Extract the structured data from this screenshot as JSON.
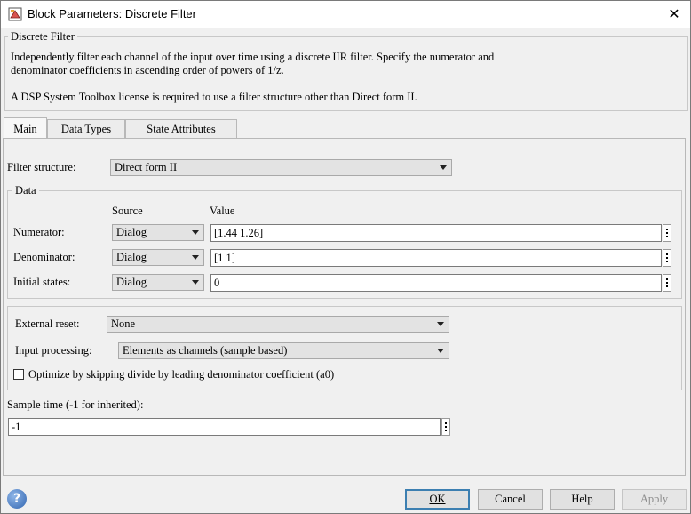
{
  "window": {
    "title": "Block Parameters: Discrete Filter",
    "close_glyph": "✕"
  },
  "description": {
    "legend": "Discrete Filter",
    "line1": "Independently filter each channel of the input over time using a discrete IIR filter. Specify the numerator and",
    "line2": "denominator coefficients in ascending order of powers of 1/z.",
    "line3": "A DSP System Toolbox license is required to use a filter structure other than Direct form II."
  },
  "tabs": [
    {
      "label": "Main",
      "active": true
    },
    {
      "label": "Data Types",
      "active": false
    },
    {
      "label": "State Attributes",
      "active": false
    }
  ],
  "filter_structure": {
    "label": "Filter structure:",
    "value": "Direct form II"
  },
  "data_group": {
    "legend": "Data",
    "source_header": "Source",
    "value_header": "Value",
    "rows": [
      {
        "label": "Numerator:",
        "source": "Dialog",
        "value": "[1.44 1.26]"
      },
      {
        "label": "Denominator:",
        "source": "Dialog",
        "value": "[1 1]"
      },
      {
        "label": "Initial states:",
        "source": "Dialog",
        "value": "0"
      }
    ]
  },
  "external_reset": {
    "label": "External reset:",
    "value": "None"
  },
  "input_processing": {
    "label": "Input processing:",
    "value": "Elements as channels (sample based)"
  },
  "optimize": {
    "label": "Optimize by skipping divide by leading denominator coefficient (a0)",
    "checked": false
  },
  "sample_time": {
    "label": "Sample time (-1 for inherited):",
    "value": "-1"
  },
  "buttons": {
    "help_glyph": "?",
    "ok": "OK",
    "cancel": "Cancel",
    "help": "Help",
    "apply": "Apply"
  }
}
